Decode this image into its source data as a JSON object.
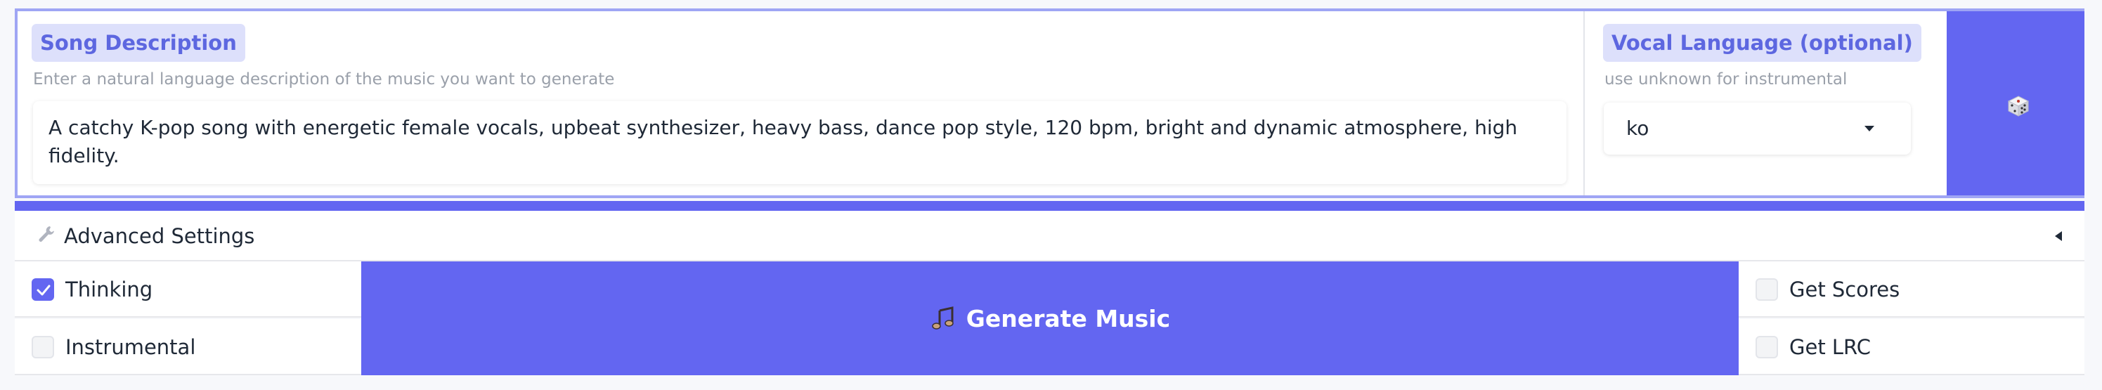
{
  "song_description": {
    "label": "Song Description",
    "info": "Enter a natural language description of the music you want to generate",
    "value": "A catchy K-pop song with energetic female vocals, upbeat synthesizer, heavy bass, dance pop style, 120 bpm, bright and dynamic atmosphere, high fidelity."
  },
  "vocal_language": {
    "label": "Vocal Language (optional)",
    "info": "use unknown for instrumental",
    "selected": "ko"
  },
  "random_button": {
    "icon": "dice-icon"
  },
  "advanced_settings": {
    "label": "Advanced Settings",
    "icon": "wrench-icon",
    "expanded": false
  },
  "options": {
    "thinking": {
      "label": "Thinking",
      "checked": true
    },
    "instrumental": {
      "label": "Instrumental",
      "checked": false
    },
    "get_scores": {
      "label": "Get Scores",
      "checked": false
    },
    "get_lrc": {
      "label": "Get LRC",
      "checked": false
    }
  },
  "generate_button": {
    "label": "Generate Music",
    "icon": "music-note-icon"
  },
  "colors": {
    "accent": "#6366f1",
    "chip_bg": "#dde0fb",
    "chip_text": "#5d67e0",
    "border": "#9fa5f4"
  }
}
